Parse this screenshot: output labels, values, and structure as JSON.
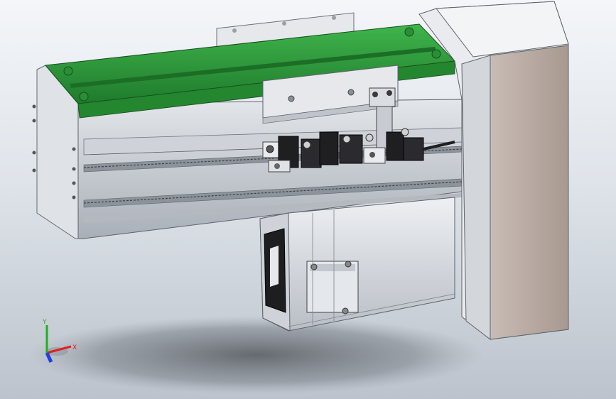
{
  "viewport": {
    "background_top": "#f4f6f9",
    "background_bottom": "#bcc3cc"
  },
  "model": {
    "carriage_color": "#2e9e3c",
    "profile_color": "#c9ced6",
    "housing_color": "#b7aaa4",
    "motor_color": "#d9dde2",
    "sensor_color": "#1f1f22"
  },
  "triad": {
    "x_label": "X",
    "y_label": "Y",
    "x_color": "#e02020",
    "y_color": "#20b020",
    "z_color": "#2040e0"
  }
}
